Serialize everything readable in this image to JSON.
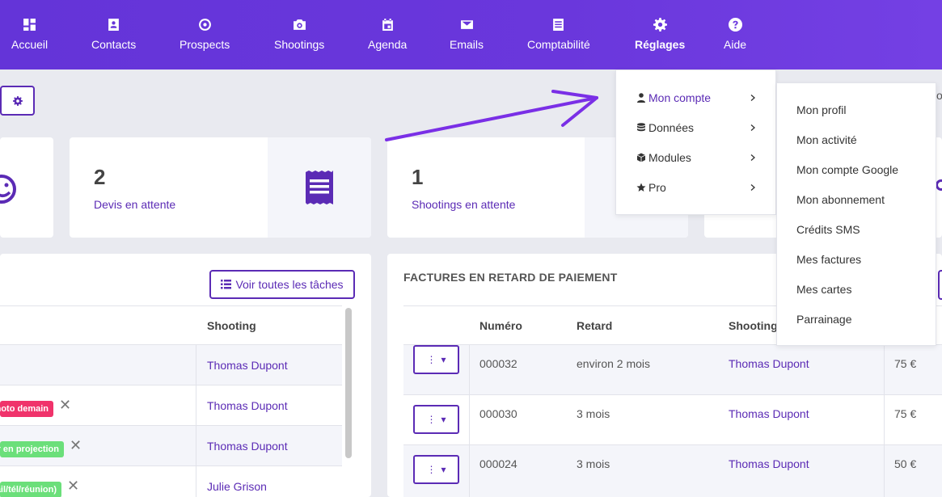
{
  "nav": {
    "items": [
      {
        "label": "Accueil"
      },
      {
        "label": "Contacts"
      },
      {
        "label": "Prospects"
      },
      {
        "label": "Shootings"
      },
      {
        "label": "Agenda"
      },
      {
        "label": "Emails"
      },
      {
        "label": "Comptabilité"
      },
      {
        "label": "Réglages"
      },
      {
        "label": "Aide"
      }
    ]
  },
  "stats": [
    {
      "value": "2",
      "label": "Devis en attente"
    },
    {
      "value": "1",
      "label": "Shootings en attente"
    }
  ],
  "tasks": {
    "button_label": "Voir toutes les tâches",
    "column_shooting": "Shooting",
    "rows": [
      {
        "tag": "",
        "shooting": "Thomas Dupont"
      },
      {
        "tag": "hoto demain",
        "shooting": "Thomas Dupont"
      },
      {
        "tag": "er en projection",
        "shooting": "Thomas Dupont"
      },
      {
        "tag": "ail/tél/réunion)",
        "shooting": "Julie Grison"
      }
    ]
  },
  "invoices": {
    "title": "FACTURES EN RETARD DE PAIEMENT",
    "columns": {
      "numero": "Numéro",
      "retard": "Retard",
      "shooting": "Shooting"
    },
    "rows": [
      {
        "numero": "000032",
        "retard": "environ 2 mois",
        "shooting": "Thomas Dupont",
        "amount": "75 €"
      },
      {
        "numero": "000030",
        "retard": "3 mois",
        "shooting": "Thomas Dupont",
        "amount": "75 €"
      },
      {
        "numero": "000024",
        "retard": "3 mois",
        "shooting": "Thomas Dupont",
        "amount": "50 €"
      }
    ]
  },
  "settings_menu": {
    "items": [
      {
        "label": "Mon compte"
      },
      {
        "label": "Données"
      },
      {
        "label": "Modules"
      },
      {
        "label": "Pro"
      }
    ]
  },
  "account_submenu": {
    "items": [
      {
        "label": "Mon profil"
      },
      {
        "label": "Mon activité"
      },
      {
        "label": "Mon compte Google"
      },
      {
        "label": "Mon abonnement"
      },
      {
        "label": "Crédits SMS"
      },
      {
        "label": "Mes factures"
      },
      {
        "label": "Mes cartes"
      },
      {
        "label": "Parrainage"
      }
    ]
  },
  "colors": {
    "brand": "#6434d8",
    "accent": "#5b2bb5",
    "tag_red": "#f0336b",
    "tag_green": "#6bdf7a",
    "arrow": "#7a2fe6"
  }
}
